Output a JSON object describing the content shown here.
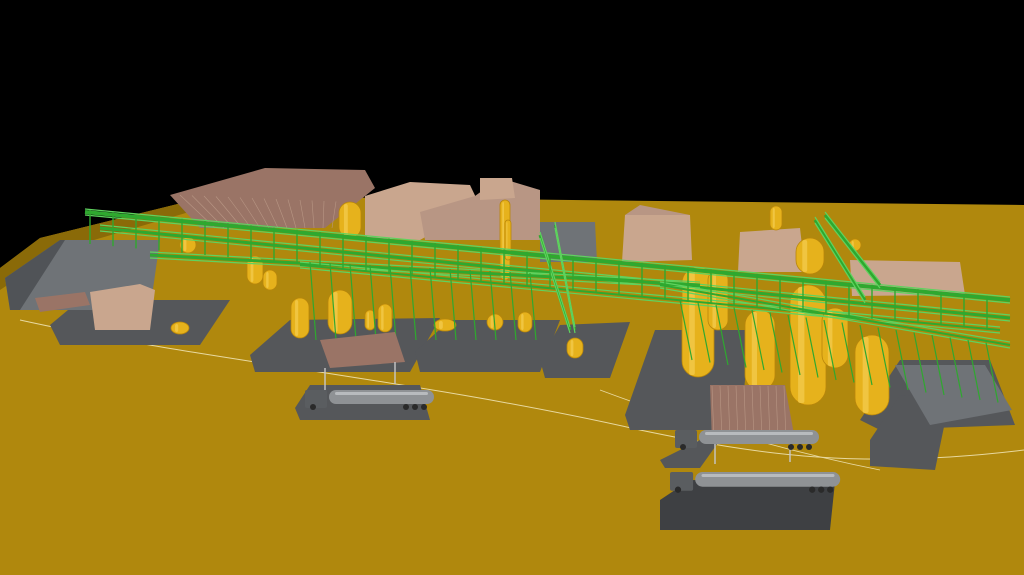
{
  "scene": {
    "colors": {
      "background": "#000000",
      "ground": "#b0880d",
      "ground_edge": "#8a6a08",
      "slab": "#55575a",
      "slab_dark": "#3e4043",
      "roof": "#9a7466",
      "roof_light": "#b89684",
      "building_tan": "#c9a68e",
      "building_side": "#8a6e60",
      "gray_building": "#6f7377",
      "gray_building_side": "#505357",
      "pipe_green": "#2fa82f",
      "pipe_green_light": "#5fd35f",
      "vessel_yellow": "#e6b21c",
      "vessel_yellow_dark": "#b8860b",
      "tanker": "#8f9295",
      "tanker_dark": "#5a5d60",
      "road_line": "#e8d9a0"
    },
    "objects": {
      "ground_icon": "industrial-ground-plane",
      "pipe_rack_icon": "pipe-rack",
      "vessel_icon": "process-vessel",
      "tanker_icon": "tanker-truck",
      "building_icon": "warehouse-building"
    }
  }
}
